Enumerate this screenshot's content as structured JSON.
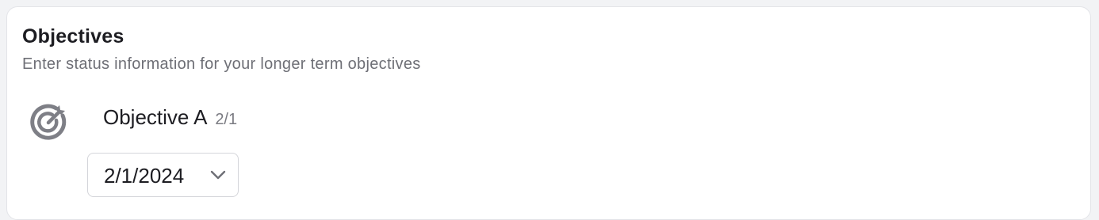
{
  "section": {
    "title": "Objectives",
    "subtitle": "Enter status information for your longer term objectives"
  },
  "objective": {
    "icon": "target-icon",
    "name": "Objective A",
    "count": "2/1",
    "date_value": "2/1/2024"
  },
  "colors": {
    "icon": "#7e7f86",
    "border": "#d4d5da"
  }
}
